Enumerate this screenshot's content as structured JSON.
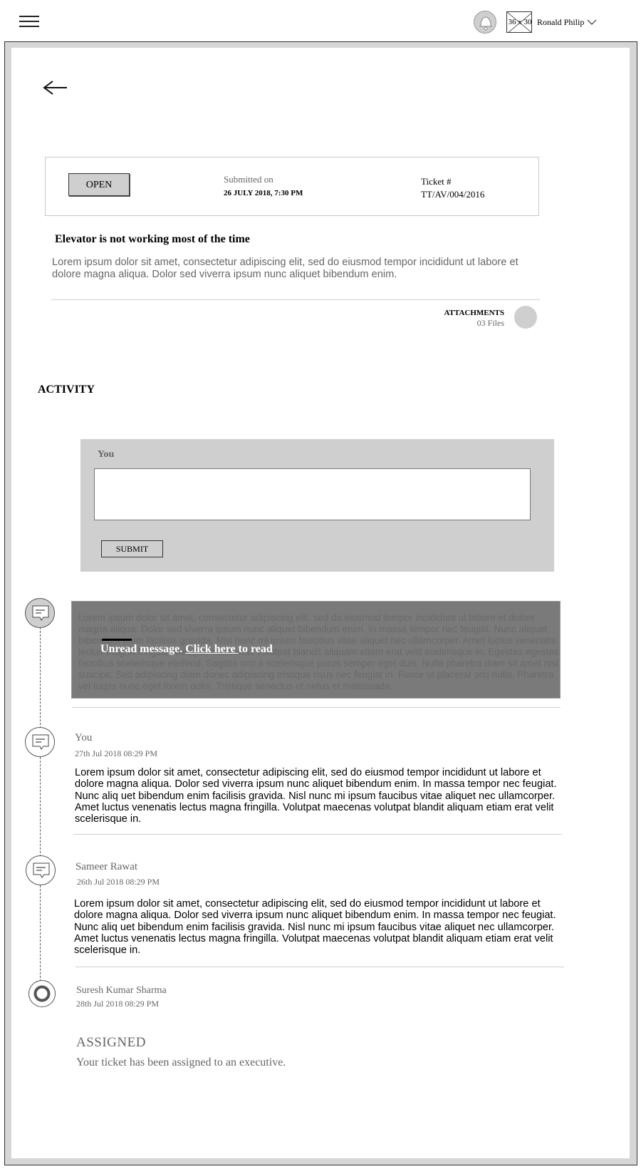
{
  "header": {
    "user_name": "Ronald Philip",
    "avatar_placeholder": "36 x 30",
    "icons": {
      "menu": "hamburger-icon",
      "notifications": "bell-icon",
      "user_menu": "chevron-down-icon"
    }
  },
  "ticket": {
    "status": "OPEN",
    "submitted_label": "Submitted on",
    "submitted_date": "26 JULY 2018, 7:30 PM",
    "ticket_label": "Ticket #",
    "ticket_number": "TT/AV/004/2016",
    "title": "Elevator is not working most of the time",
    "description": "Lorem ipsum dolor sit amet, consectetur adipiscing elit, sed do eiusmod tempor incididunt ut labore et dolore magna aliqua. Dolor sed viverra ipsum nunc aliquet bibendum enim.",
    "attachments_label": "ATTACHMENTS",
    "attachments_count": "03 Files"
  },
  "activity": {
    "heading": "ACTIVITY",
    "reply": {
      "author": "You",
      "input_value": "",
      "submit_label": "SUBMIT"
    },
    "unread": {
      "background_text": "Lorem ipsum dolor sit amet, consectetur adipiscing elit, sed do eiusmod tempor incididunt ut labore et dolore magna aliqua. Dolor sed viverra ipsum nunc aliquet bibendum enim. In massa tempor nec feugiat. Nunc aliquet bibendum enim facilisis gravida. Nisl nunc mi ipsum faucibus vitae aliquet nec ullamcorper. Amet luctus venenatis lectus magna fringilla. Volutpat maecenas volutpat blandit aliquam etiam erat velit scelerisque in. Egestas egestas faucibus scelerisque eleifend. Sagittis orci a scelerisque purus semper eget duis. Nulla pharetra diam sit amet nisl suscipit. Sed adipiscing diam donec adipiscing tristique risus nec feugiat in. Fusce ut placerat orci nulla. Pharetra vel turpis nunc eget lorem dolor. Tristique senectus et netus et malesuada.",
      "message_prefix": "Unread message. ",
      "link_text": "Click here ",
      "message_suffix": "to read"
    },
    "comments": [
      {
        "author": "You",
        "timestamp": "27th Jul 2018 08:29 PM",
        "body": "Lorem ipsum dolor sit amet, consectetur adipiscing elit, sed do eiusmod tempor incididunt ut labore et dolore magna aliqua. Dolor sed viverra ipsum nunc aliquet bibendum enim. In massa tempor nec feugiat. Nunc aliq uet bibendum enim facilisis gravida. Nisl nunc mi ipsum faucibus vitae aliquet nec ullamcorper. Amet luctus venenatis lectus magna fringilla. Volutpat maecenas volutpat blandit aliquam etiam erat velit scelerisque in."
      },
      {
        "author": "Sameer Rawat",
        "timestamp": "26th Jul 2018 08:29 PM",
        "body": "Lorem ipsum dolor sit amet, consectetur adipiscing elit, sed do eiusmod tempor incididunt ut labore et dolore magna aliqua. Dolor sed viverra ipsum nunc aliquet bibendum enim. In massa tempor nec feugiat. Nunc aliq uet bibendum enim facilisis gravida. Nisl nunc mi ipsum faucibus vitae aliquet nec ullamcorper. Amet luctus venenatis lectus magna fringilla. Volutpat maecenas volutpat blandit aliquam etiam erat velit scelerisque in."
      }
    ],
    "assignment": {
      "author": "Suresh Kumar Sharma",
      "timestamp": "28th Jul 2018 08:29 PM",
      "status": "ASSIGNED",
      "message": "Your ticket has been assigned to an executive."
    }
  }
}
